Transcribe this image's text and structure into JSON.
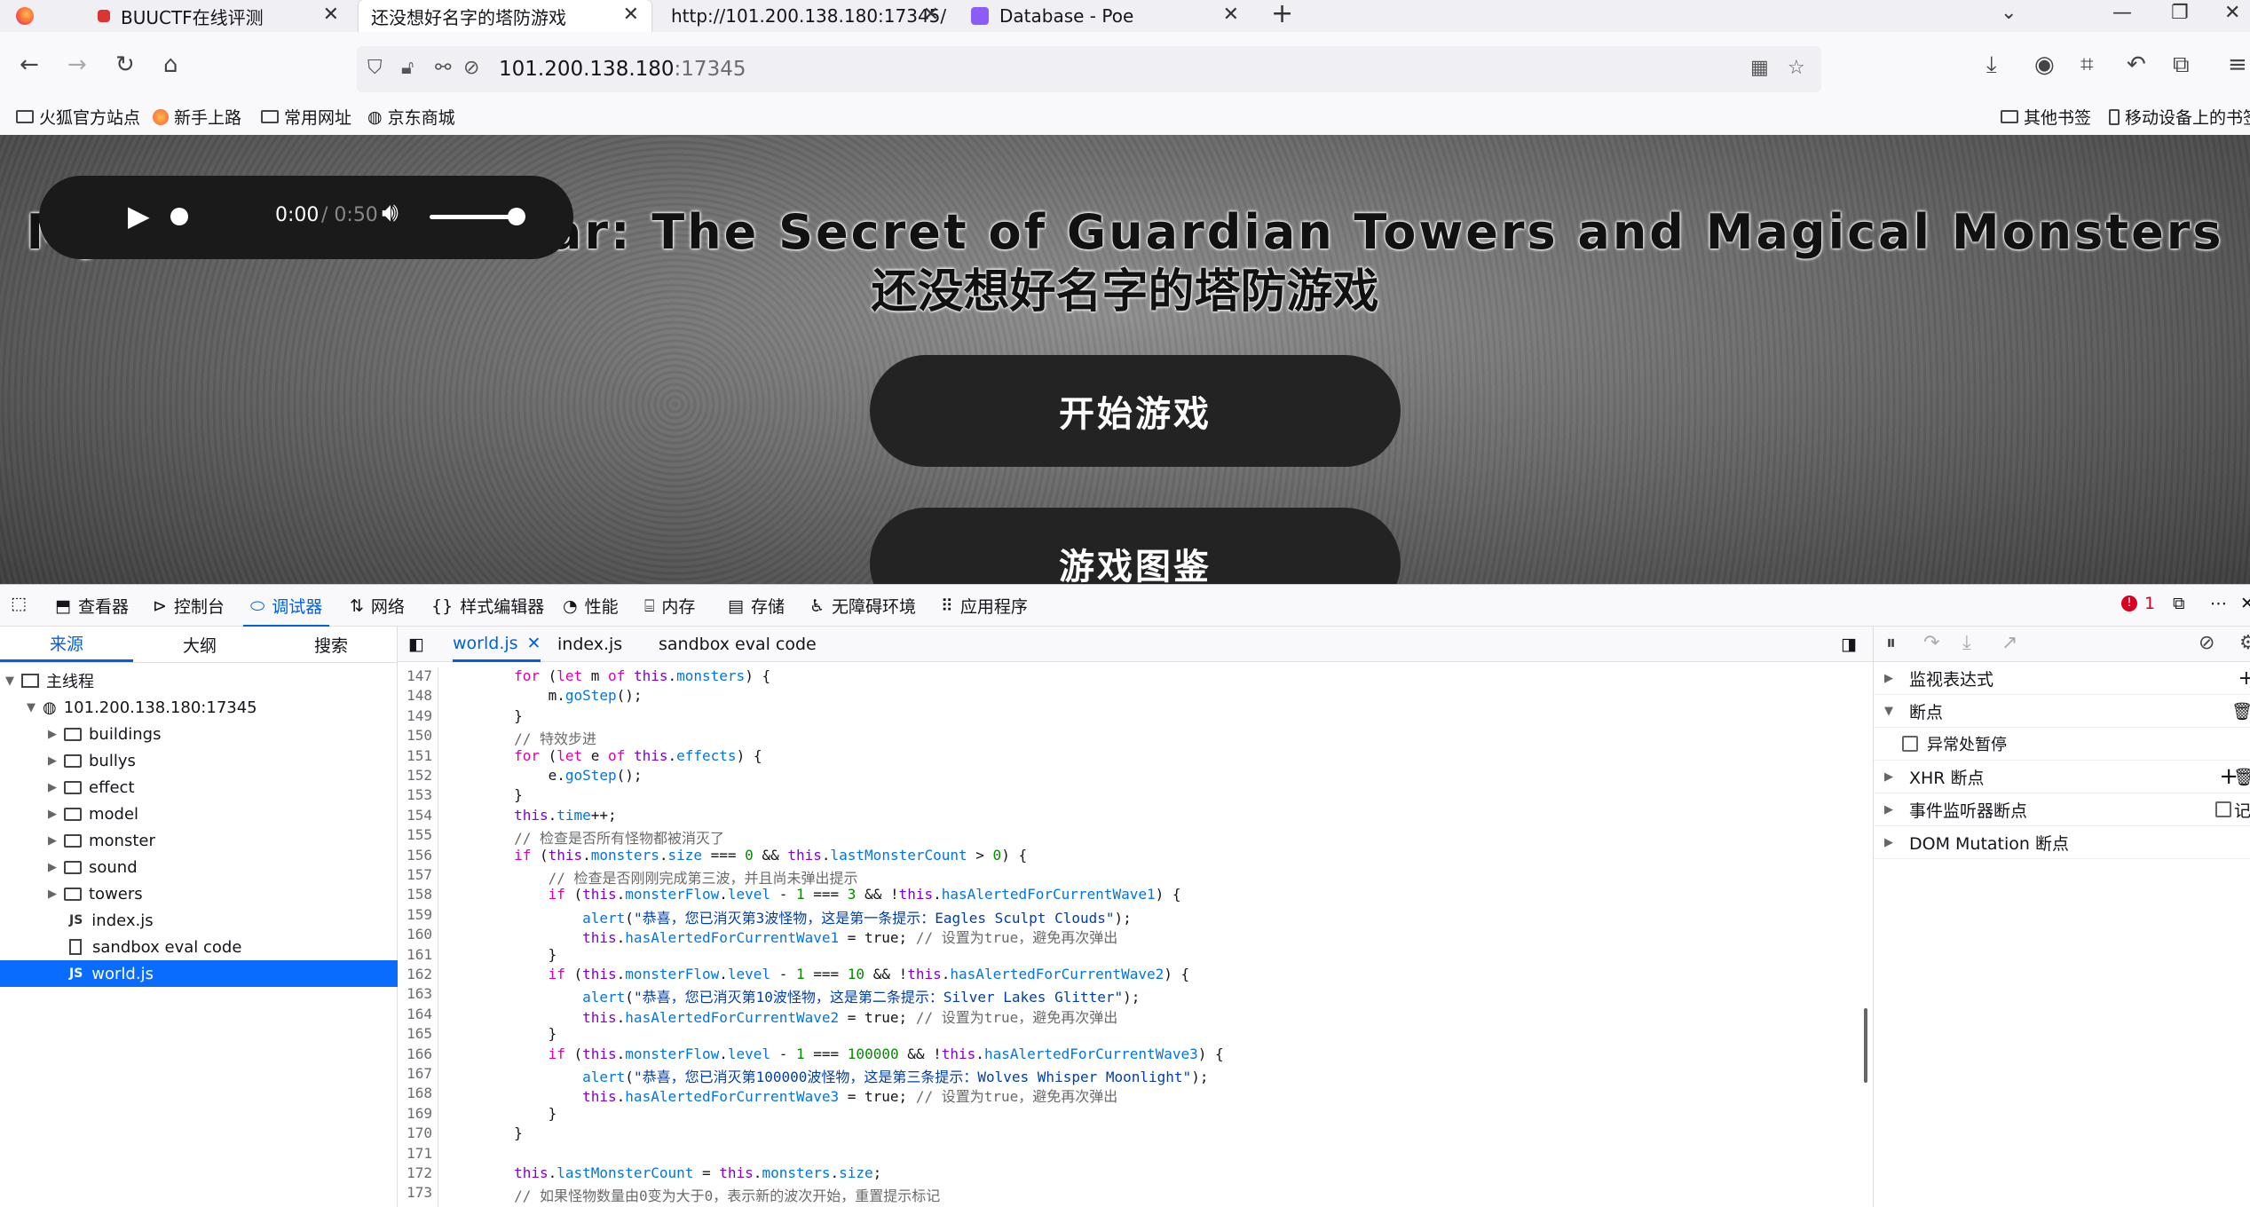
{
  "browser": {
    "tabs": [
      {
        "title": "BUUCTF在线评测",
        "favicon_color": "#d33"
      },
      {
        "title": "还没想好名字的塔防游戏",
        "active": true
      },
      {
        "title": "http://101.200.138.180:17345/"
      },
      {
        "title": "Database - Poe",
        "favicon_color": "#8b5cf6"
      }
    ],
    "new_tab": "+",
    "url_host": "101.200.138.180",
    "url_port": ":17345",
    "bookmarks": [
      "火狐官方站点",
      "新手上路",
      "常用网址",
      "京东商城"
    ],
    "bookmarks_right": [
      "其他书签",
      "移动设备上的书签"
    ]
  },
  "page": {
    "audio_time": "0:00",
    "audio_duration": " / 0:50",
    "title_en": "Mystic Defense War: The Secret of Guardian Towers and Magical Monsters",
    "title_cn": "还没想好名字的塔防游戏",
    "btn_start": "开始游戏",
    "btn_gallery": "游戏图鉴"
  },
  "devtools": {
    "tools": [
      "查看器",
      "控制台",
      "调试器",
      "网络",
      "样式编辑器",
      "性能",
      "内存",
      "存储",
      "无障碍环境",
      "应用程序"
    ],
    "active_tool": "调试器",
    "error_count": "1",
    "left_tabs": [
      "来源",
      "大纲",
      "搜索"
    ],
    "tree": {
      "thread": "主线程",
      "host": "101.200.138.180:17345",
      "folders": [
        "buildings",
        "bullys",
        "effect",
        "model",
        "monster",
        "sound",
        "towers"
      ],
      "files": [
        "index.js",
        "sandbox eval code",
        "world.js"
      ]
    },
    "editor_tabs": [
      "world.js",
      "index.js",
      "sandbox eval code"
    ],
    "line_numbers": [
      "147",
      "148",
      "149",
      "150",
      "151",
      "152",
      "153",
      "154",
      "155",
      "156",
      "157",
      "158",
      "159",
      "160",
      "161",
      "162",
      "163",
      "164",
      "165",
      "166",
      "167",
      "168",
      "169",
      "170",
      "171",
      "172",
      "173"
    ],
    "right": {
      "watch": "监视表达式",
      "breakpoints": "断点",
      "pause_exceptions": "异常处暂停",
      "xhr": "XHR 断点",
      "events": "事件监听器断点",
      "dom": "DOM Mutation 断点",
      "log_label": "记"
    },
    "code_lines": [
      "        for (let m of this.monsters) {",
      "            m.goStep();",
      "        }",
      "        // 特效步进",
      "        for (let e of this.effects) {",
      "            e.goStep();",
      "        }",
      "        this.time++;",
      "        // 检查是否所有怪物都被消灭了",
      "        if (this.monsters.size === 0 && this.lastMonsterCount > 0) {",
      "            // 检查是否刚刚完成第三波，并且尚未弹出提示",
      "            if (this.monsterFlow.level - 1 === 3 && !this.hasAlertedForCurrentWave1) {",
      "                alert(\"恭喜，您已消灭第3波怪物，这是第一条提示：Eagles Sculpt Clouds\");",
      "                this.hasAlertedForCurrentWave1 = true; // 设置为true，避免再次弹出",
      "            }",
      "            if (this.monsterFlow.level - 1 === 10 && !this.hasAlertedForCurrentWave2) {",
      "                alert(\"恭喜，您已消灭第10波怪物，这是第二条提示：Silver Lakes Glitter\");",
      "                this.hasAlertedForCurrentWave2 = true; // 设置为true，避免再次弹出",
      "            }",
      "            if (this.monsterFlow.level - 1 === 100000 && !this.hasAlertedForCurrentWave3) {",
      "                alert(\"恭喜，您已消灭第100000波怪物，这是第三条提示：Wolves Whisper Moonlight\");",
      "                this.hasAlertedForCurrentWave3 = true; // 设置为true，避免再次弹出",
      "            }",
      "        }",
      "",
      "        this.lastMonsterCount = this.monsters.size;",
      "        // 如果怪物数量由0变为大于0，表示新的波次开始，重置提示标记"
    ]
  }
}
